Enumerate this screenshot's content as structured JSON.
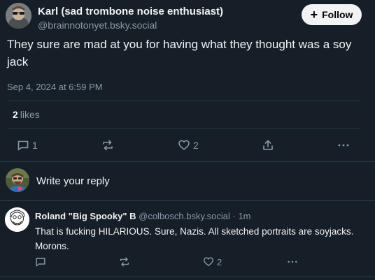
{
  "post": {
    "author_name": "Karl (sad trombone noise enthusiast)",
    "author_handle": "@brainnotonyet.bsky.social",
    "follow_label": "Follow",
    "text": "They sure are mad at you for having what they thought was a soy jack",
    "date": "Sep 4, 2024 at 6:59 PM",
    "likes_count": "2",
    "likes_label": "likes",
    "actions": {
      "reply_count": "1",
      "repost_count": "",
      "like_count": "2"
    }
  },
  "reply_box": {
    "placeholder": "Write your reply"
  },
  "reply": {
    "author_name": "Roland \"Big Spooky\" B",
    "author_handle": "@colbosch.bsky.social",
    "separator": "·",
    "time": "1m",
    "text": "That is fucking HILARIOUS. Sure, Nazis. All sketched portraits are soyjacks. Morons.",
    "actions": {
      "like_count": "2"
    }
  },
  "icons": {
    "reply": "comment-icon",
    "repost": "repost-icon",
    "like": "heart-icon",
    "share": "share-icon",
    "more": "more-dots-icon",
    "follow": "plus-icon"
  },
  "colors": {
    "background": "#161e27",
    "text": "#f1f3f5",
    "muted": "#8a98a8",
    "divider": "#2e3a47",
    "button_bg": "#f1f3f5"
  }
}
